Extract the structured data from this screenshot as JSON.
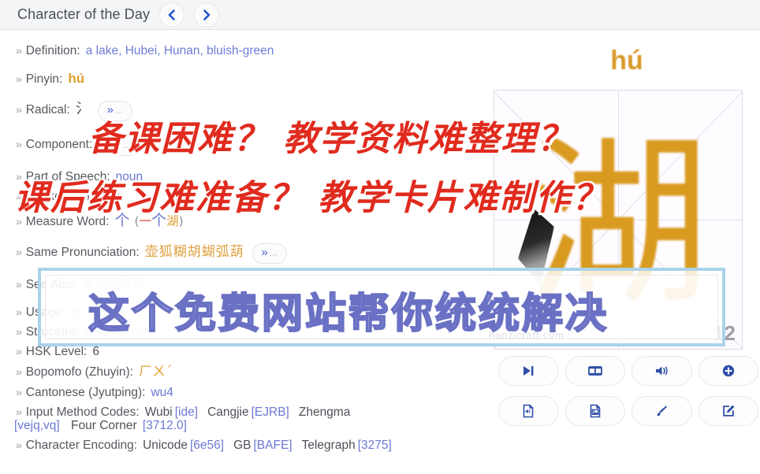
{
  "header": {
    "title": "Character of the Day",
    "prev_label": "‹",
    "next_label": "›"
  },
  "entry": {
    "definition": {
      "label": "Definition",
      "value": "a lake, Hubei, Hunan, bluish-green"
    },
    "pinyin": {
      "label": "Pinyin",
      "value": "hú"
    },
    "radical": {
      "label": "Radical",
      "value": "氵",
      "more": "»"
    },
    "component": {
      "label": "Component",
      "value": "",
      "more": "»"
    },
    "part_of_speech": {
      "label": "Part of Speech",
      "value": "noun"
    },
    "stroke_count": {
      "label": "Stroke Count",
      "value": "12"
    },
    "measure_word": {
      "label": "Measure Word",
      "value": "个",
      "example_open": "(",
      "example_one": "一",
      "example_mw": "个",
      "example_noun": "湖",
      "example_close": ")"
    },
    "same_pronunciation": {
      "label": "Same Pronunciation",
      "value": "壶狐糊胡蝴弧葫",
      "more": "»"
    },
    "see_also": {
      "label": "See Also",
      "value": "湓湯潖湾翟"
    },
    "usage": {
      "label": "Usage",
      "value": "★★☆☆☆"
    },
    "structure": {
      "label": "Structure",
      "value": "Left to Right"
    },
    "hsk_level": {
      "label": "HSK Level",
      "value": "6"
    },
    "bopomofo": {
      "label": "Bopomofo (Zhuyin)",
      "value": "ㄏㄨˊ"
    },
    "cantonese": {
      "label": "Cantonese (Jyutping)",
      "value": "wu4"
    },
    "input_method": {
      "label": "Input Method Codes",
      "wubi_label": "Wubi",
      "wubi_value": "[ide]",
      "cangjie_label": "Cangjie",
      "cangjie_value": "[EJRB]",
      "zhengma_label": "Zhengma",
      "zhengma_value": "[vejq,vq]",
      "four_corner_label": "Four Corner",
      "four_corner_value": "[3712.0]"
    },
    "encoding": {
      "label": "Character Encoding",
      "unicode_label": "Unicode",
      "unicode_value": "[6e56]",
      "gb_label": "GB",
      "gb_value": "[BAFE]",
      "telegraph_label": "Telegraph",
      "telegraph_value": "[3275]"
    }
  },
  "preview": {
    "pinyin": "hú",
    "character": "湖",
    "stroke_number": "12",
    "watermark": "hanzicraft.com"
  },
  "actions": [
    {
      "name": "step-forward",
      "label": "Step"
    },
    {
      "name": "animation",
      "label": "Animation"
    },
    {
      "name": "audio",
      "label": "Audio"
    },
    {
      "name": "add",
      "label": "Add"
    },
    {
      "name": "export-audio-file",
      "label": "Audio file"
    },
    {
      "name": "export-image-file",
      "label": "Image file"
    },
    {
      "name": "brush",
      "label": "Brush"
    },
    {
      "name": "edit",
      "label": "Edit"
    }
  ],
  "overlay": {
    "red_line_1": "备课困难？ 教学资料难整理？",
    "red_line_2": "课后练习难准备？ 教学卡片难制作？",
    "blue_text": "这个免费网站帮你统统解决",
    "blue_watermark": "hanzicraft.com"
  },
  "colors": {
    "accent_blue": "#6b78d4",
    "accent_orange": "#dfa13f",
    "red": "#e02b1e",
    "box_border": "#a9d3ea"
  }
}
